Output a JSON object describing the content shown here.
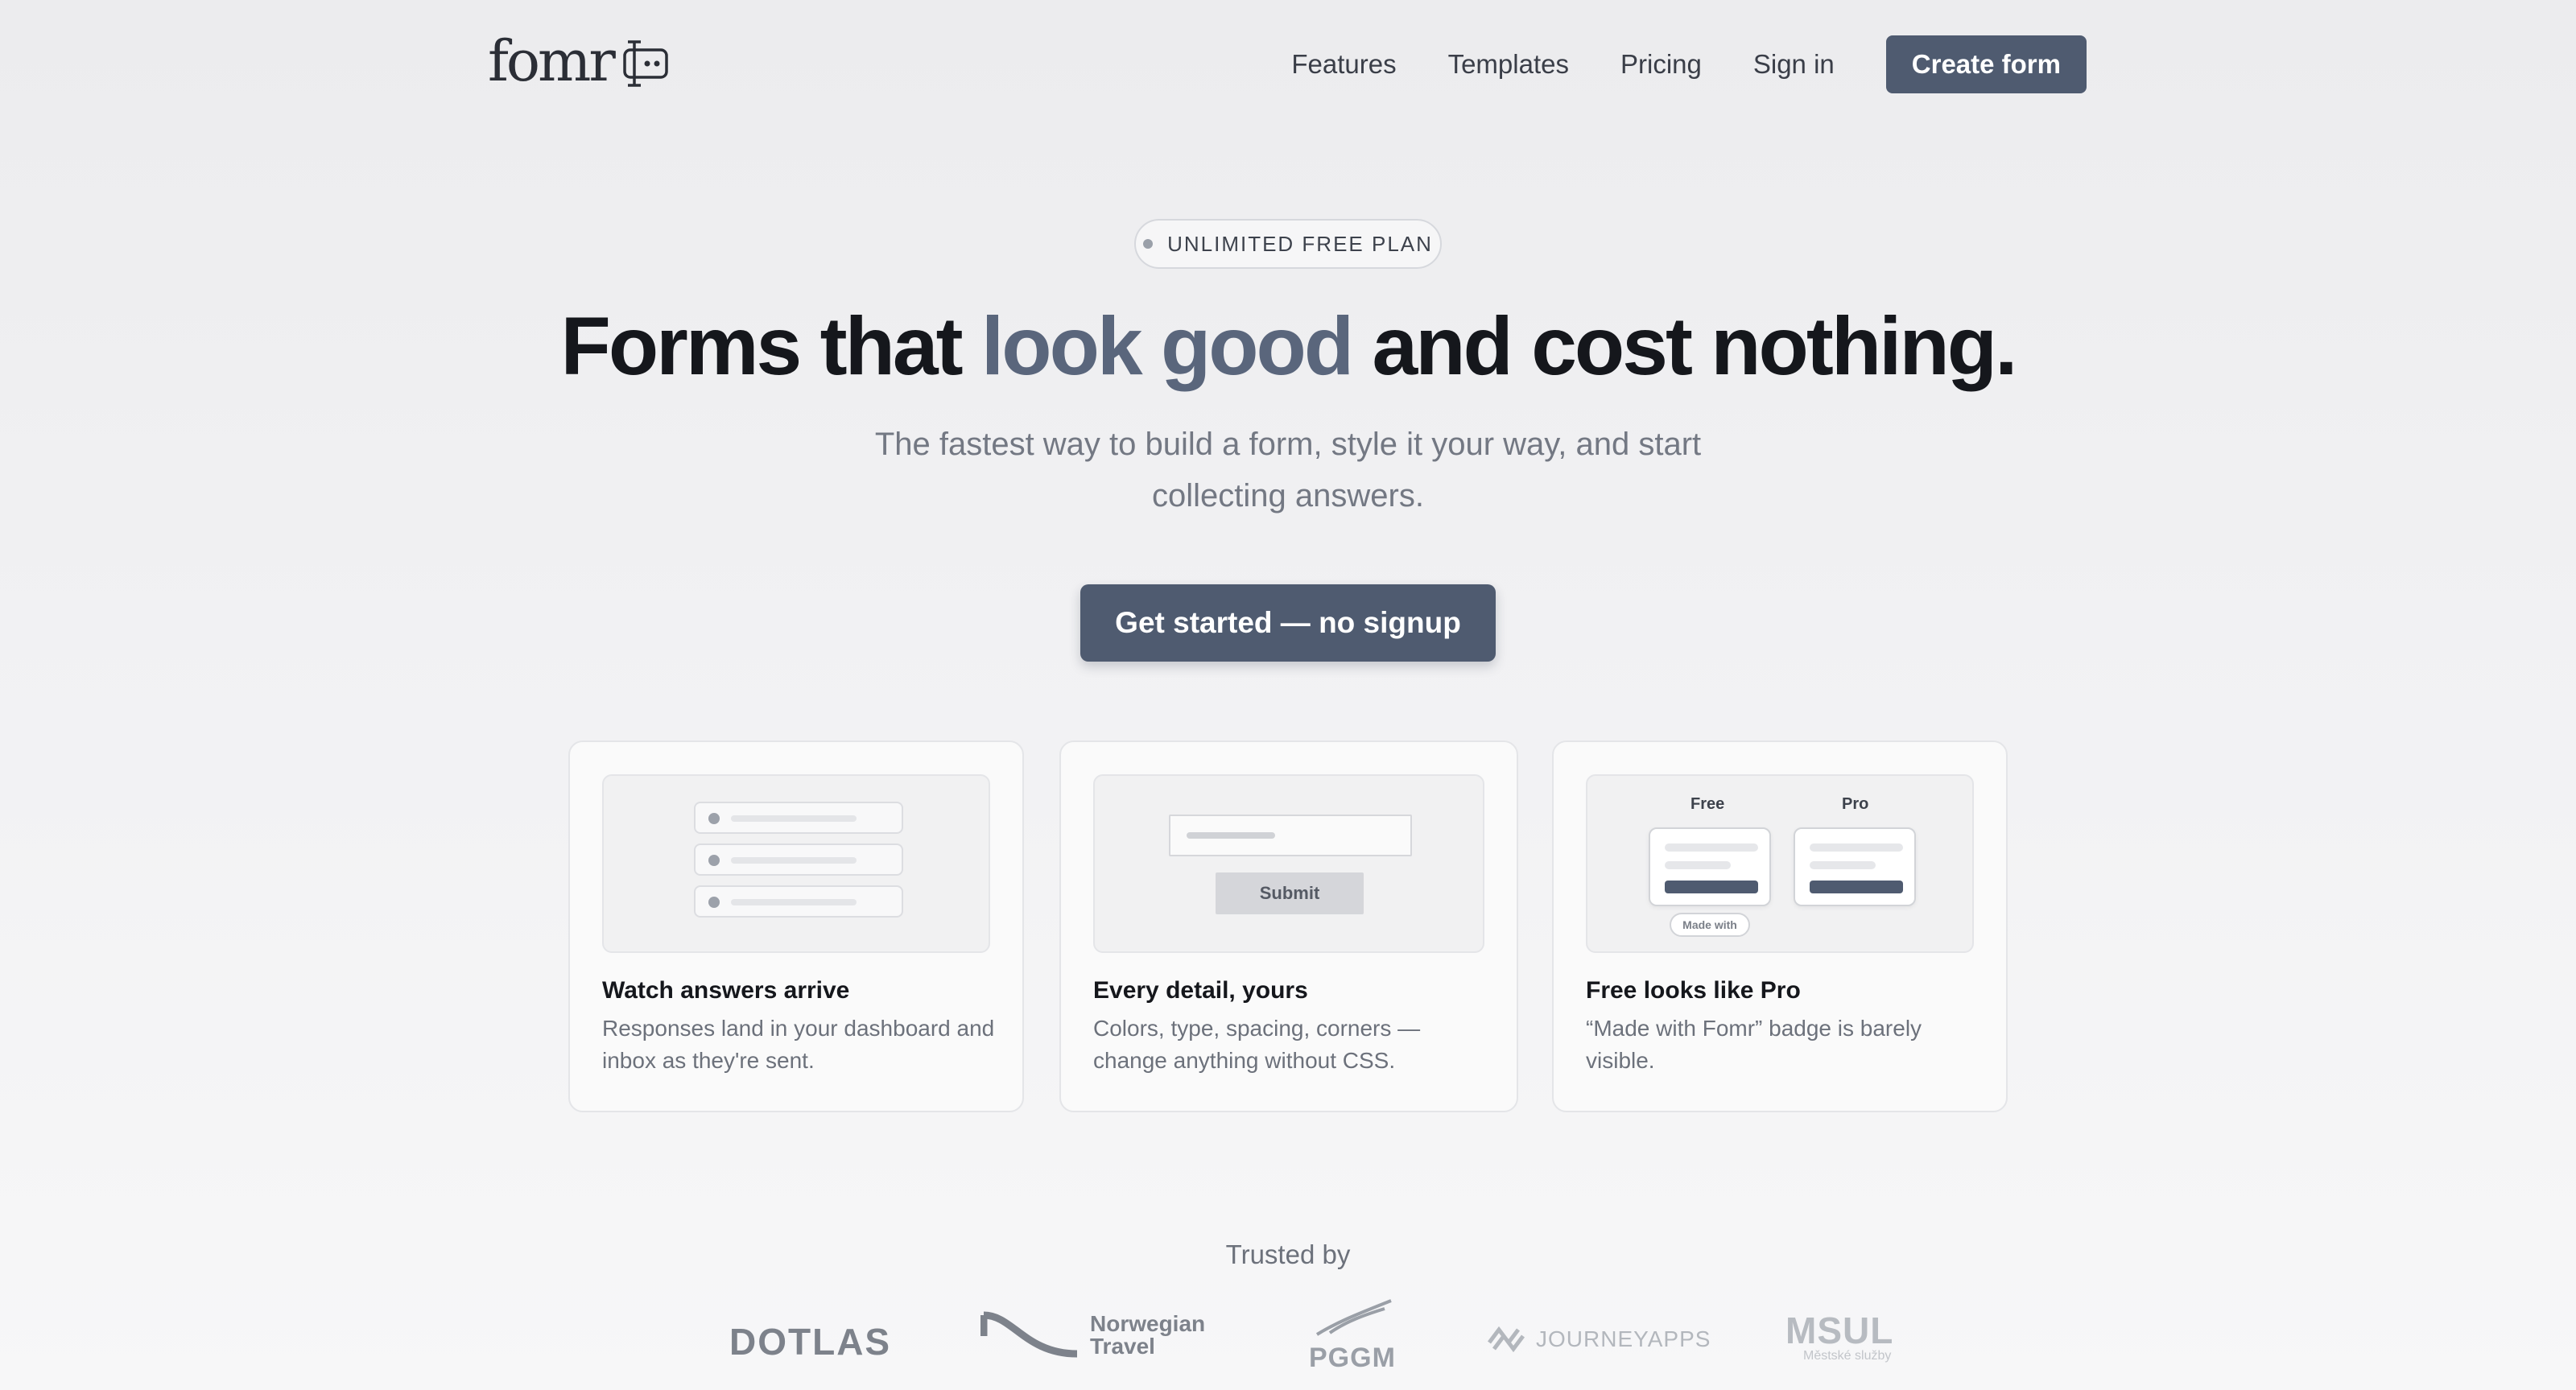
{
  "header": {
    "logo_text": "fomr",
    "nav": [
      "Features",
      "Templates",
      "Pricing",
      "Sign in"
    ],
    "create_label": "Create form"
  },
  "hero": {
    "badge": "UNLIMITED FREE PLAN",
    "headline_pre": "Forms that ",
    "headline_accent": "look good",
    "headline_post": " and cost nothing.",
    "subheading": "The fastest way to build a form, style it your way, and start collecting answers.",
    "cta_label": "Get started — no signup"
  },
  "features": [
    {
      "title": "Watch answers arrive",
      "description": "Responses land in your dashboard and inbox as they're sent."
    },
    {
      "title": "Every detail, yours",
      "description": "Colors, type, spacing, corners — change anything without CSS.",
      "submit_label": "Submit"
    },
    {
      "title": "Free looks like Pro",
      "description": "“Made with Fomr” badge is barely visible.",
      "free_label": "Free",
      "pro_label": "Pro",
      "badge_label": "Made with"
    }
  ],
  "trusted": {
    "label": "Trusted by",
    "brands": [
      {
        "name": "DOTLAS"
      },
      {
        "name": "Norwegian",
        "sub": "Travel"
      },
      {
        "name": "PGGM"
      },
      {
        "name": "JOURNEYAPPS"
      },
      {
        "name": "MSUL",
        "sub": "Městské služby"
      }
    ]
  },
  "colors": {
    "accent": "#4f5b70",
    "headline_accent": "#5a667c",
    "text_dark": "#15171c",
    "text_muted": "#6c717b"
  }
}
